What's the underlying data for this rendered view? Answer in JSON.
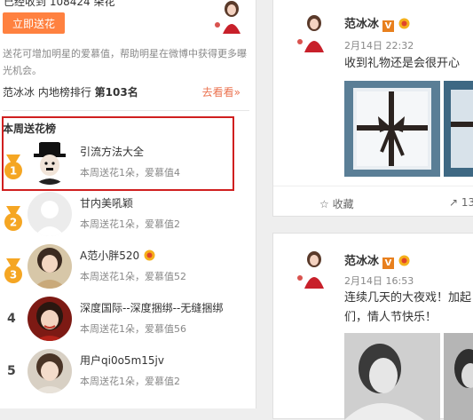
{
  "flower_panel": {
    "top_text": "已经收到 108424 朵花",
    "send_button": "立即送花",
    "description": "送花可增加明星的爱慕值，帮助明星在微博中获得更多曝光机会。",
    "rank_prefix": "范冰冰 内地榜排行",
    "rank_value": "第103名",
    "see_link": "去看看»"
  },
  "weekly": {
    "title": "本周送花榜",
    "entries": [
      {
        "rank": "1",
        "name": "引流方法大全",
        "sub": "本周送花1朵，爱慕值4",
        "medal_color": "#f5a623"
      },
      {
        "rank": "2",
        "name": "甘内美吼颖",
        "sub": "本周送花1朵，爱慕值2",
        "medal_color": "#f5a623"
      },
      {
        "rank": "3",
        "name": "A范小胖520",
        "sub": "本周送花1朵，爱慕值52",
        "medal_color": "#f5a623"
      },
      {
        "rank": "4",
        "name": "深度国际--深度捆绑--无缝捆绑",
        "sub": "本周送花1朵，爱慕值56"
      },
      {
        "rank": "5",
        "name": "用户qi0o5m15jv",
        "sub": "本周送花1朵，爱慕值2"
      }
    ]
  },
  "posts": [
    {
      "name": "范冰冰",
      "verified": "V",
      "date": "2月14日 22:32",
      "text": "收到礼物还是会很开心",
      "fav_label": "收藏",
      "fwd_count": "13"
    },
    {
      "name": "范冰冰",
      "verified": "V",
      "date": "2月14日 16:53",
      "text": "连续几天的大夜戏！加起们，情人节快乐！"
    }
  ],
  "colors": {
    "accent": "#ff8140",
    "highlight_border": "#d01f1f",
    "link": "#eb7350"
  }
}
